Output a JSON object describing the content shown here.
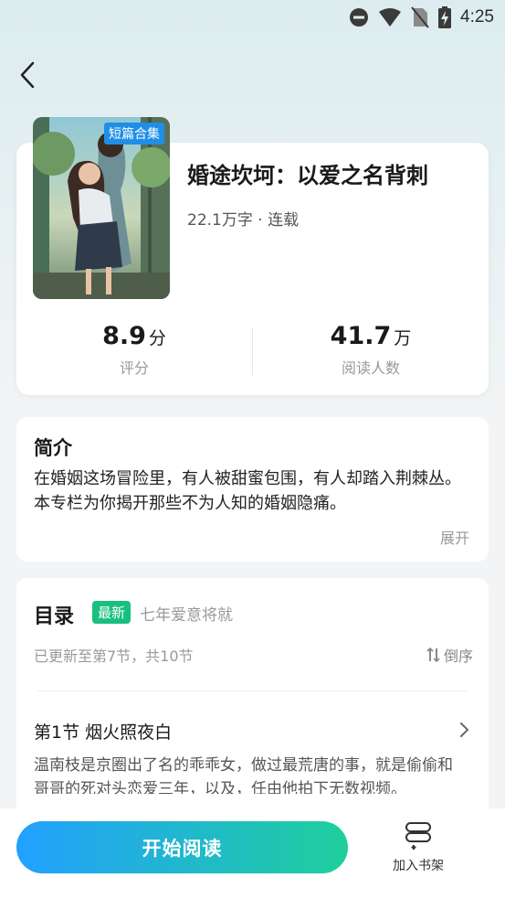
{
  "status_bar": {
    "time": "4:25"
  },
  "book": {
    "cover_tag": "短篇合集",
    "title": "婚途坎坷：以爱之名背刺",
    "meta": "22.1万字 · 连载",
    "rating": {
      "value": "8.9",
      "unit": "分",
      "label": "评分"
    },
    "readers": {
      "value": "41.7",
      "unit": "万",
      "label": "阅读人数"
    }
  },
  "intro": {
    "heading": "简介",
    "line1": "在婚姻这场冒险里，有人被甜蜜包围，有人却踏入荆棘丛。",
    "line2": "本专栏为你揭开那些不为人知的婚姻隐痛。",
    "expand": "展开"
  },
  "toc": {
    "heading": "目录",
    "badge": "最新",
    "latest": "七年爱意将就",
    "updated": "已更新至第7节，共10节",
    "sort": "倒序",
    "chapter_title": "第1节 烟火照夜白",
    "chapter_desc": "温南枝是京圈出了名的乖乖女，做过最荒唐的事，就是偷偷和哥哥的死对头恋爱三年，以及，任由他拍下无数视频。"
  },
  "bottom": {
    "read_button": "开始阅读",
    "add_shelf": "加入书架"
  },
  "colors": {
    "accent_blue": "#1f8fe6",
    "accent_green": "#19c07d"
  }
}
